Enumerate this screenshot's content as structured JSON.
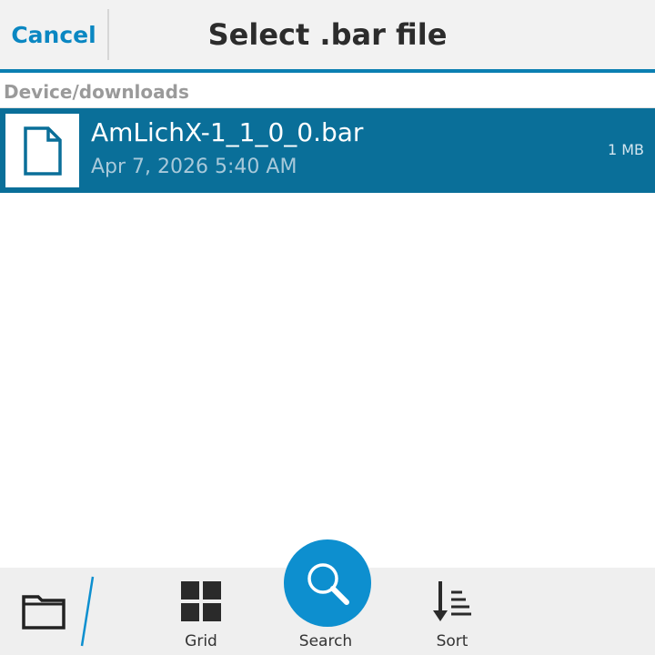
{
  "titlebar": {
    "cancel_label": "Cancel",
    "title": "Select .bar file"
  },
  "path": {
    "label": "Device/downloads"
  },
  "files": [
    {
      "name": "AmLichX-1_1_0_0.bar",
      "date": "Apr 7, 2026 5:40 AM",
      "size": "1 MB",
      "icon": "document-icon",
      "selected": true
    }
  ],
  "actionbar": {
    "folder_icon": "folder-icon",
    "grid_label": "Grid",
    "search_label": "Search",
    "sort_label": "Sort"
  },
  "colors": {
    "accent": "#0b7fb2",
    "selected_row": "#0a6f99",
    "search_button": "#0d8fcf",
    "cancel_text": "#0a87c2"
  }
}
